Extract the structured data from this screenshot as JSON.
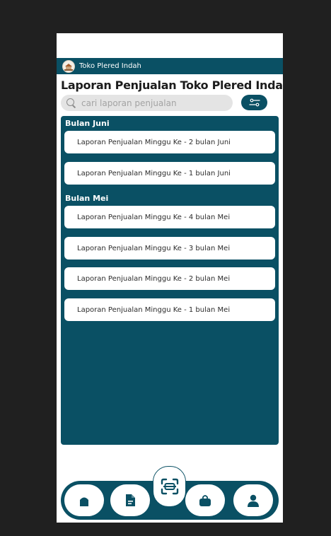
{
  "app": {
    "store_name": "Toko Plered Indah",
    "page_title": "Laporan Penjualan Toko Plered Indah"
  },
  "search": {
    "placeholder": "cari laporan penjualan",
    "value": ""
  },
  "colors": {
    "primary": "#0a5064",
    "background": "#ffffff",
    "search_bg": "#e4e4e4",
    "frame": "#202020"
  },
  "sections": [
    {
      "label": "Bulan Juni",
      "items": [
        "Laporan Penjualan Minggu Ke - 2 bulan Juni",
        "Laporan Penjualan Minggu Ke - 1 bulan Juni"
      ]
    },
    {
      "label": "Bulan Mei",
      "items": [
        "Laporan Penjualan Minggu Ke - 4 bulan Mei",
        "Laporan Penjualan Minggu Ke - 3 bulan Mei",
        "Laporan Penjualan Minggu Ke - 2 bulan Mei",
        "Laporan Penjualan Minggu Ke - 1 bulan Mei"
      ]
    }
  ],
  "nav": {
    "items": [
      "home-icon",
      "document-icon",
      "scan-icon",
      "shopping-bag-icon",
      "user-icon"
    ]
  }
}
